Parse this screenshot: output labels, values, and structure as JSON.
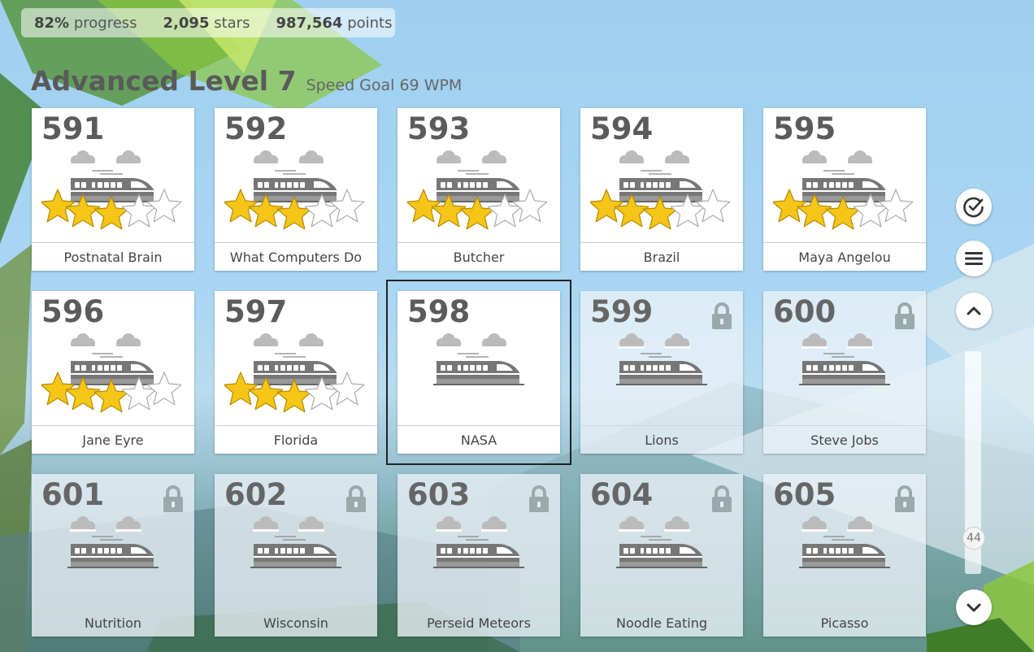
{
  "stats": {
    "progress_value": "82%",
    "progress_label": "progress",
    "stars_value": "2,095",
    "stars_label": "stars",
    "points_value": "987,564",
    "points_label": "points"
  },
  "header": {
    "title": "Advanced Level 7",
    "subtitle": "Speed Goal 69 WPM"
  },
  "lessons": [
    {
      "number": "591",
      "name": "Postnatal Brain",
      "stars": 3,
      "locked": false,
      "selected": false
    },
    {
      "number": "592",
      "name": "What Computers Do",
      "stars": 3,
      "locked": false,
      "selected": false
    },
    {
      "number": "593",
      "name": "Butcher",
      "stars": 3,
      "locked": false,
      "selected": false
    },
    {
      "number": "594",
      "name": "Brazil",
      "stars": 3,
      "locked": false,
      "selected": false
    },
    {
      "number": "595",
      "name": "Maya Angelou",
      "stars": 3,
      "locked": false,
      "selected": false
    },
    {
      "number": "596",
      "name": "Jane Eyre",
      "stars": 3,
      "locked": false,
      "selected": false
    },
    {
      "number": "597",
      "name": "Florida",
      "stars": 3,
      "locked": false,
      "selected": false
    },
    {
      "number": "598",
      "name": "NASA",
      "stars": 0,
      "locked": false,
      "selected": true
    },
    {
      "number": "599",
      "name": "Lions",
      "stars": 0,
      "locked": true,
      "selected": false
    },
    {
      "number": "600",
      "name": "Steve Jobs",
      "stars": 0,
      "locked": true,
      "selected": false
    },
    {
      "number": "601",
      "name": "Nutrition",
      "stars": 0,
      "locked": true,
      "selected": false
    },
    {
      "number": "602",
      "name": "Wisconsin",
      "stars": 0,
      "locked": true,
      "selected": false
    },
    {
      "number": "603",
      "name": "Perseid Meteors",
      "stars": 0,
      "locked": true,
      "selected": false
    },
    {
      "number": "604",
      "name": "Noodle Eating",
      "stars": 0,
      "locked": true,
      "selected": false
    },
    {
      "number": "605",
      "name": "Picasso",
      "stars": 0,
      "locked": true,
      "selected": false
    }
  ],
  "sidebar": {
    "buttons": [
      "check-circle-icon",
      "menu-icon",
      "chevron-up-icon",
      "chevron-down-icon"
    ],
    "scroll_level": "44"
  },
  "colors": {
    "star": "#f5c518",
    "star_empty": "#ffffff",
    "train": "#777777",
    "cloud": "#bbbbbb"
  }
}
